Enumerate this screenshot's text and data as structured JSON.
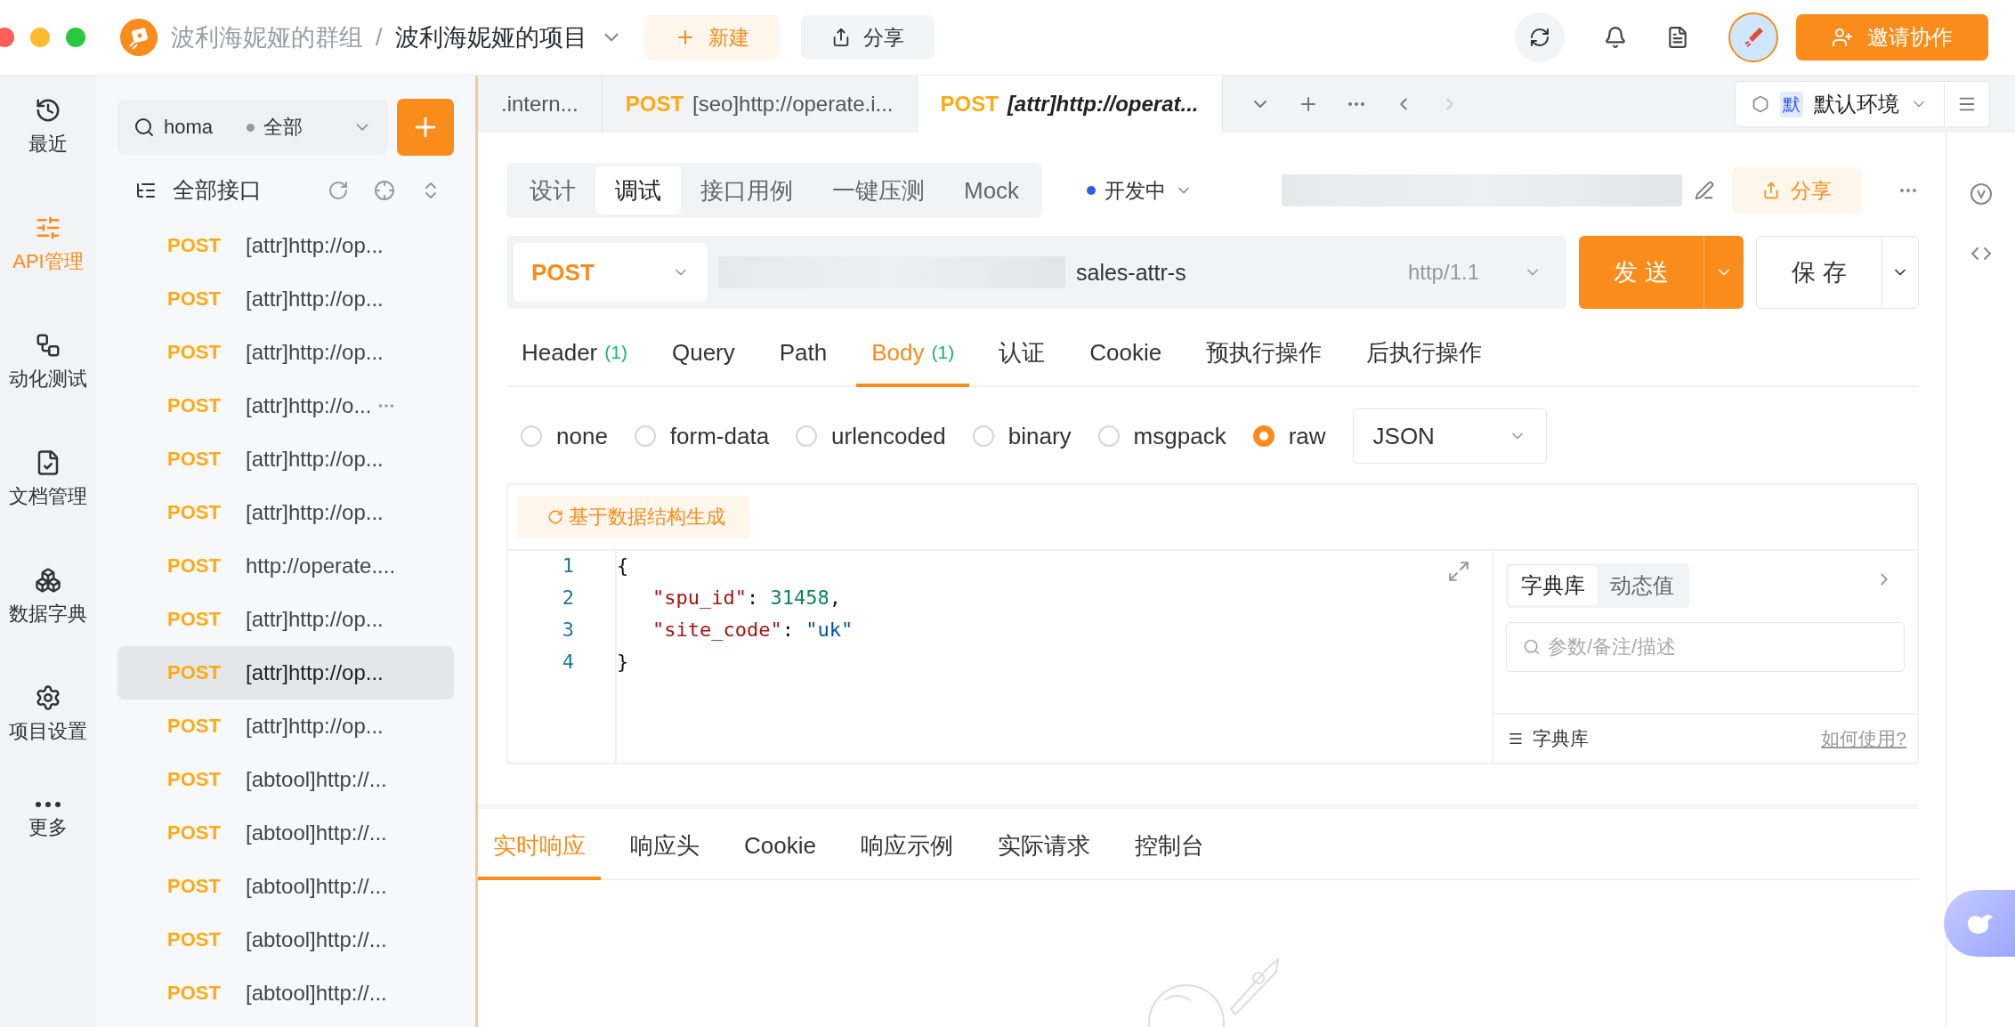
{
  "topbar": {
    "group": "波利海妮娅的群组",
    "separator": "/",
    "project": "波利海妮娅的项目",
    "new_button": "新建",
    "share_button": "分享",
    "invite_button": "邀请协作"
  },
  "nav": [
    {
      "label": "最近",
      "selected": false
    },
    {
      "label": "API管理",
      "selected": true
    },
    {
      "label": "动化测试",
      "selected": false
    },
    {
      "label": "文档管理",
      "selected": false
    },
    {
      "label": "数据字典",
      "selected": false
    },
    {
      "label": "项目设置",
      "selected": false
    },
    {
      "label": "更多",
      "selected": false
    }
  ],
  "sidebar": {
    "search": {
      "value": "homa",
      "filter": "全部"
    },
    "tree_title": "全部接口",
    "items": [
      {
        "method": "POST",
        "label": "[attr]http://op...",
        "selected": false,
        "show_more": false
      },
      {
        "method": "POST",
        "label": "[attr]http://op...",
        "selected": false,
        "show_more": false
      },
      {
        "method": "POST",
        "label": "[attr]http://op...",
        "selected": false,
        "show_more": false
      },
      {
        "method": "POST",
        "label": "[attr]http://o...",
        "selected": false,
        "show_more": true
      },
      {
        "method": "POST",
        "label": "[attr]http://op...",
        "selected": false,
        "show_more": false
      },
      {
        "method": "POST",
        "label": "[attr]http://op...",
        "selected": false,
        "show_more": false
      },
      {
        "method": "POST",
        "label": "http://operate....",
        "selected": false,
        "show_more": false
      },
      {
        "method": "POST",
        "label": "[attr]http://op...",
        "selected": false,
        "show_more": false
      },
      {
        "method": "POST",
        "label": "[attr]http://op...",
        "selected": true,
        "show_more": false
      },
      {
        "method": "POST",
        "label": "[attr]http://op...",
        "selected": false,
        "show_more": false
      },
      {
        "method": "POST",
        "label": "[abtool]http://...",
        "selected": false,
        "show_more": false
      },
      {
        "method": "POST",
        "label": "[abtool]http://...",
        "selected": false,
        "show_more": false
      },
      {
        "method": "POST",
        "label": "[abtool]http://...",
        "selected": false,
        "show_more": false
      },
      {
        "method": "POST",
        "label": "[abtool]http://...",
        "selected": false,
        "show_more": false
      },
      {
        "method": "POST",
        "label": "[abtool]http://...",
        "selected": false,
        "show_more": false
      }
    ]
  },
  "tabs": [
    {
      "title": ".intern...",
      "selected": false
    },
    {
      "method": "POST",
      "title": "[seo]http://operate.i...",
      "selected": false
    },
    {
      "method": "POST",
      "title": "[attr]http://operat...",
      "selected": true
    }
  ],
  "environment": {
    "badge": "默",
    "name": "默认环境"
  },
  "mode_tabs": [
    {
      "label": "设计",
      "selected": false
    },
    {
      "label": "调试",
      "selected": true
    },
    {
      "label": "接口用例",
      "selected": false
    },
    {
      "label": "一键压测",
      "selected": false
    },
    {
      "label": "Mock",
      "selected": false
    }
  ],
  "status": {
    "label": "开发中",
    "color": "#2f5bea"
  },
  "share_button": "分享",
  "request": {
    "method": "POST",
    "url_tail": "sales-attr-s",
    "protocol": "http/1.1",
    "send_button": "发 送",
    "save_button": "保 存"
  },
  "param_tabs": [
    {
      "label": "Header",
      "count": "(1)",
      "selected": false
    },
    {
      "label": "Query",
      "selected": false
    },
    {
      "label": "Path",
      "selected": false
    },
    {
      "label": "Body",
      "count": "(1)",
      "selected": true
    },
    {
      "label": "认证",
      "selected": false
    },
    {
      "label": "Cookie",
      "selected": false
    },
    {
      "label": "预执行操作",
      "selected": false
    },
    {
      "label": "后执行操作",
      "selected": false
    }
  ],
  "body_types": [
    {
      "label": "none",
      "selected": false
    },
    {
      "label": "form-data",
      "selected": false
    },
    {
      "label": "urlencoded",
      "selected": false
    },
    {
      "label": "binary",
      "selected": false
    },
    {
      "label": "msgpack",
      "selected": false
    },
    {
      "label": "raw",
      "selected": true
    }
  ],
  "format": "JSON",
  "generate_button": "基于数据结构生成",
  "code": [
    {
      "number": "1",
      "indented": false,
      "tokens": [
        {
          "kind": "punct",
          "text": "{"
        }
      ]
    },
    {
      "number": "2",
      "indented": true,
      "tokens": [
        {
          "kind": "key",
          "text": "\"spu_id\""
        },
        {
          "kind": "punct",
          "text": ": "
        },
        {
          "kind": "number",
          "text": "31458"
        },
        {
          "kind": "punct",
          "text": ","
        }
      ]
    },
    {
      "number": "3",
      "indented": true,
      "tokens": [
        {
          "kind": "key",
          "text": "\"site_code\""
        },
        {
          "kind": "punct",
          "text": ": "
        },
        {
          "kind": "string",
          "text": "\"uk\""
        }
      ]
    },
    {
      "number": "4",
      "indented": false,
      "tokens": [
        {
          "kind": "punct",
          "text": "}"
        }
      ]
    }
  ],
  "dictionary": {
    "tabs": [
      {
        "label": "字典库",
        "selected": true
      },
      {
        "label": "动态值",
        "selected": false
      }
    ],
    "search_placeholder": "参数/备注/描述",
    "footer": "字典库",
    "help_link": "如何使用?"
  },
  "response_tabs": [
    {
      "label": "实时响应",
      "selected": true
    },
    {
      "label": "响应头",
      "selected": false
    },
    {
      "label": "Cookie",
      "selected": false
    },
    {
      "label": "响应示例",
      "selected": false
    },
    {
      "label": "实际请求",
      "selected": false
    },
    {
      "label": "控制台",
      "selected": false
    }
  ]
}
